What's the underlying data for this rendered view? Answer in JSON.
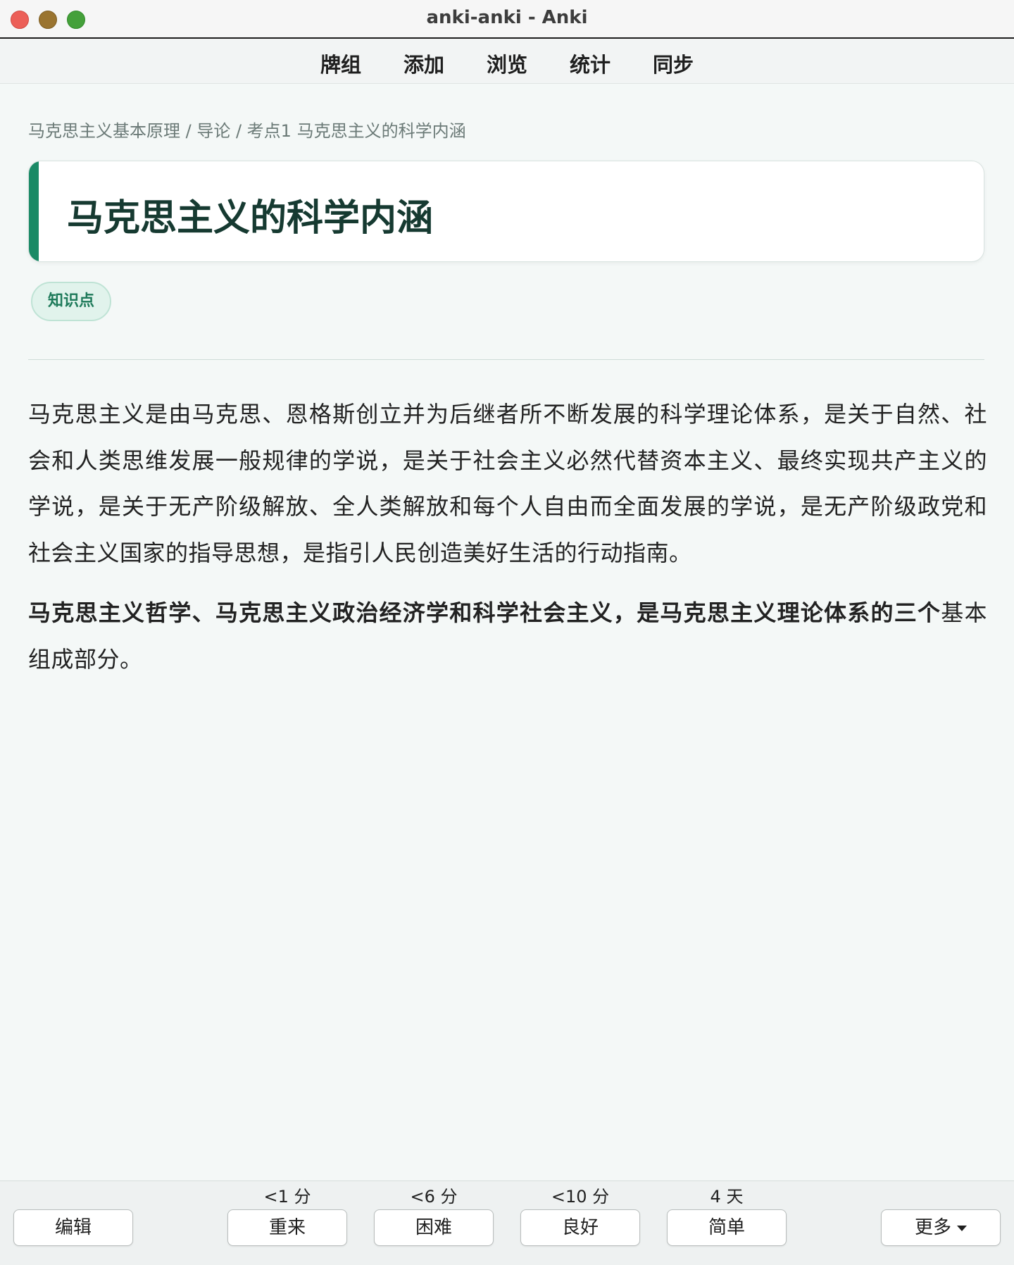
{
  "window": {
    "title": "anki-anki - Anki"
  },
  "toolbar": {
    "items": [
      "牌组",
      "添加",
      "浏览",
      "统计",
      "同步"
    ]
  },
  "card": {
    "breadcrumb": "马克思主义基本原理 / 导论 / 考点1 马克思主义的科学内涵",
    "title": "马克思主义的科学内涵",
    "tag": "知识点",
    "paragraph1": "马克思主义是由马克思、恩格斯创立并为后继者所不断发展的科学理论体系，是关于自然、社会和人类思维发展一般规律的学说，是关于社会主义必然代替资本主义、最终实现共产主义的学说，是关于无产阶级解放、全人类解放和每个人自由而全面发展的学说，是无产阶级政党和社会主义国家的指导思想，是指引人民创造美好生活的行动指南。",
    "paragraph2_bold": "马克思主义哲学、马克思主义政治经济学和科学社会主义，是马克思主义理论体系的三个",
    "paragraph2_rest": "基本组成部分。"
  },
  "bottombar": {
    "edit_label": "编辑",
    "more_label": "更多",
    "answers": [
      {
        "interval": "<1 分",
        "label": "重来"
      },
      {
        "interval": "<6 分",
        "label": "困难"
      },
      {
        "interval": "<10 分",
        "label": "良好"
      },
      {
        "interval": "4 天",
        "label": "简单"
      }
    ]
  },
  "colors": {
    "accent": "#1a8a66",
    "background": "#f4f8f7",
    "tag_background": "#e1f3ec"
  }
}
